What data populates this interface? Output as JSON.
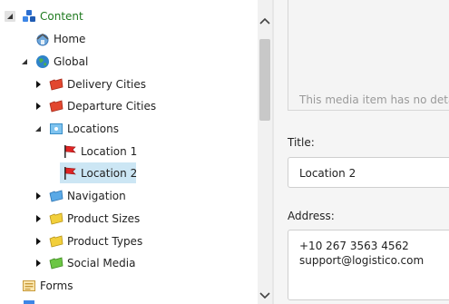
{
  "tree": {
    "items": [
      {
        "label": "Content",
        "icon": "content-cubes-icon"
      },
      {
        "label": "Home",
        "icon": "home-globe-icon"
      },
      {
        "label": "Global",
        "icon": "globe-icon"
      },
      {
        "label": "Delivery Cities",
        "icon": "red-folder-icon"
      },
      {
        "label": "Departure Cities",
        "icon": "red-folder-icon"
      },
      {
        "label": "Locations",
        "icon": "locations-folder-icon"
      },
      {
        "label": "Location 1",
        "icon": "red-flag-icon"
      },
      {
        "label": "Location 2",
        "icon": "red-flag-icon"
      },
      {
        "label": "Navigation",
        "icon": "blue-folder-icon"
      },
      {
        "label": "Product Sizes",
        "icon": "yellow-folder-icon"
      },
      {
        "label": "Product Types",
        "icon": "yellow-folder-icon"
      },
      {
        "label": "Social Media",
        "icon": "green-folder-icon"
      },
      {
        "label": "Forms",
        "icon": "forms-icon"
      }
    ],
    "selected": "Location 2"
  },
  "detail": {
    "media_note": "This media item has no details.",
    "title_label": "Title:",
    "title_value": "Location 2",
    "address_label": "Address:",
    "address_value": "+10 267 3563 4562\nsupport@logistico.com"
  },
  "colors": {
    "content_label": "#1f7a1f",
    "selection": "#cce6f4",
    "detail_bg": "#f5f5f5"
  }
}
